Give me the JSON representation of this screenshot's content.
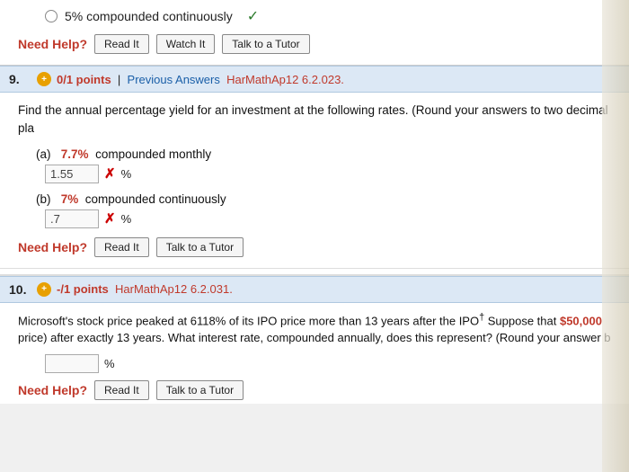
{
  "top": {
    "answer_text": "5% compounded continuously",
    "checkmark": "✓",
    "need_help": "Need Help?",
    "btn_read": "Read It",
    "btn_watch": "Watch It",
    "btn_tutor": "Talk to a Tutor"
  },
  "q9": {
    "number": "9.",
    "badge": "+",
    "points": "0/1 points",
    "separator": "|",
    "prev_answers": "Previous Answers",
    "source": "HarMathAp12 6.2.023.",
    "question": "Find the annual percentage yield for an investment at the following rates. (Round your answers to two decimal pla",
    "part_a_label": "(a)",
    "part_a_rate": "7.7%",
    "part_a_type": "compounded monthly",
    "part_a_value": "1.55",
    "part_a_percent": "%",
    "part_b_label": "(b)",
    "part_b_rate": "7%",
    "part_b_type": "compounded continuously",
    "part_b_value": ".7",
    "part_b_percent": "%",
    "need_help": "Need Help?",
    "btn_read": "Read It",
    "btn_tutor": "Talk to a Tutor"
  },
  "q10": {
    "number": "10.",
    "badge": "+",
    "points": "-/1 points",
    "source": "HarMathAp12 6.2.031.",
    "question_part1": "Microsoft's stock price peaked at 6118% of its IPO price more than 13 years after the IPO",
    "superscript": "†",
    "question_part2": " Suppose that ",
    "highlight": "$50,000",
    "question_part3": " price) after exactly 13 years. What interest rate, compounded annually, does this represent? (Round your answer b",
    "input_value": "",
    "percent": "%",
    "need_help": "Need Help?",
    "btn_read": "Read It",
    "btn_tutor": "Talk to a Tutor"
  }
}
